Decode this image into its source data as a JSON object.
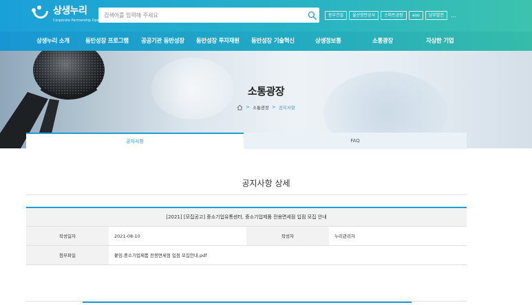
{
  "header": {
    "logo_title": "상생누리",
    "logo_sub": "Corporate Partnership Open Platform",
    "search_placeholder": "검색어를 입력해 주세요",
    "quick_links": [
      "동부건설",
      "울산항만공사",
      "스마트공장",
      "aoo",
      "남부발전"
    ],
    "more": "..."
  },
  "nav": {
    "items": [
      "상생누리 소개",
      "동반성장 프로그램",
      "공공기관 동반성장",
      "동반성장 투자재원",
      "동반성장 기술혁신",
      "상생정보통",
      "소통광장",
      "자상한 기업"
    ]
  },
  "hero": {
    "title": "소통광장",
    "breadcrumb": [
      "소통광장",
      "공지사항"
    ],
    "sep": ">"
  },
  "tabs": {
    "active": "공지사항",
    "inactive": "FAQ"
  },
  "page": {
    "heading": "공지사항 상세"
  },
  "detail": {
    "title": "[2021] [모집공고] 중소기업유통센터, 중소기업제품 전용면세점 입점 모집 안내",
    "date_label": "작성일자",
    "date_value": "2021-08-10",
    "author_label": "작성자",
    "author_value": "누리관리자",
    "attach_label": "첨부파일",
    "attach_value": "붙임.중소기업제품 전용면세점 입점 모집안내.pdf"
  },
  "colors": {
    "accent": "#1f9bd6",
    "header_start": "#1aa0d8",
    "header_end": "#3dc3ad"
  },
  "icons": {
    "search": "search-icon",
    "home": "home-icon",
    "logo": "logo-icon"
  }
}
